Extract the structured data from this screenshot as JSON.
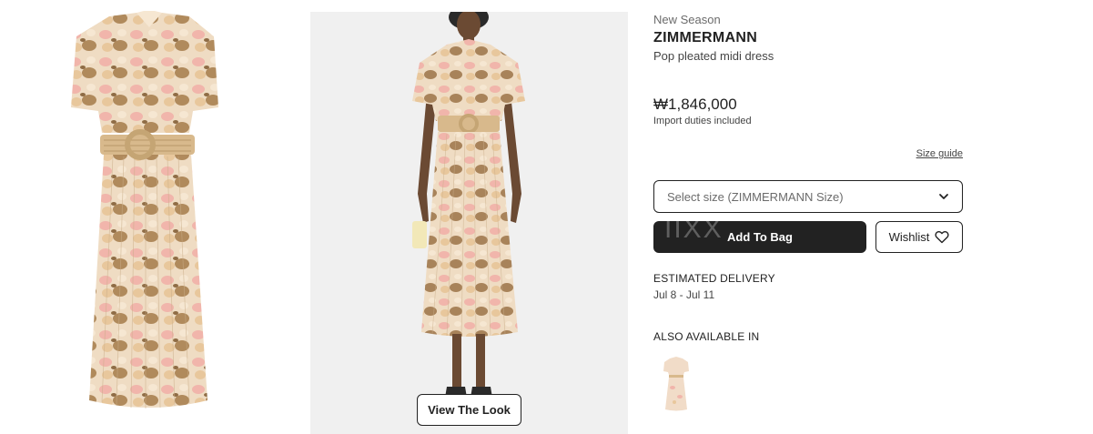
{
  "product": {
    "season": "New Season",
    "brand": "ZIMMERMANN",
    "name": "Pop pleated midi dress",
    "price": "₩1,846,000",
    "duties_note": "Import duties included"
  },
  "size": {
    "guide_label": "Size guide",
    "select_placeholder": "Select size (ZIMMERMANN Size)"
  },
  "actions": {
    "add_to_bag": "Add To Bag",
    "add_to_bag_overlay": "IIXX",
    "wishlist": "Wishlist",
    "view_the_look": "View The Look"
  },
  "delivery": {
    "label": "ESTIMATED DELIVERY",
    "range": "Jul 8 - Jul 11"
  },
  "also_available": {
    "label": "ALSO AVAILABLE IN"
  },
  "colors": {
    "dress_base": "#efdcc3",
    "dress_pink": "#f1b5ab",
    "dress_brown": "#9b7a52",
    "belt": "#d8b98c",
    "button_dark": "#222222",
    "model_bg": "#f0f0f0"
  },
  "icons": {
    "select_chevron": "chevron-down-icon",
    "wishlist_heart": "heart-icon"
  }
}
